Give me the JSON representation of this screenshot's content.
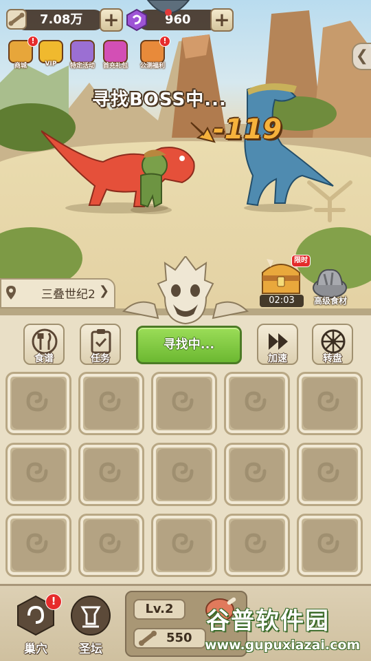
{
  "top_bar": {
    "bones_value": "7.08万",
    "gems_value": "960"
  },
  "menu": [
    {
      "name": "shop",
      "label": "商城",
      "alert": "!",
      "color": "#e7a63a"
    },
    {
      "name": "vip",
      "label": "VIP",
      "color": "#f0b92e"
    },
    {
      "name": "special-event",
      "label": "特定活动",
      "color": "#9b6fd3"
    },
    {
      "name": "first-recharge",
      "label": "首充礼包",
      "color": "#d34fb5"
    },
    {
      "name": "welfare",
      "label": "公测福利",
      "alert": "!",
      "color": "#e88a3a"
    }
  ],
  "scene": {
    "status_text": "寻找BOSS中...",
    "damage_text": "-119"
  },
  "chest": {
    "badge": "限时",
    "timer": "02:03"
  },
  "advanced_food": {
    "label": "高级食材"
  },
  "stage": {
    "name": "三叠世纪2"
  },
  "tools": {
    "recipe": "食谱",
    "task": "任务",
    "search_button": "寻找中...",
    "speed_up": "加速",
    "wheel": "转盘"
  },
  "grid": {
    "rows": 3,
    "cols": 5
  },
  "bottom_nav": {
    "nest": "巢穴",
    "altar": "圣坛",
    "nest_alert": "!",
    "level": "Lv.2",
    "bones": "550"
  },
  "watermark": {
    "title": "谷普软件园",
    "url": "www.gupuxiazai.com"
  },
  "colors": {
    "accent_green": "#7cc43a",
    "panel_bg": "#e9dfc6",
    "alert_red": "#e62c2c"
  }
}
